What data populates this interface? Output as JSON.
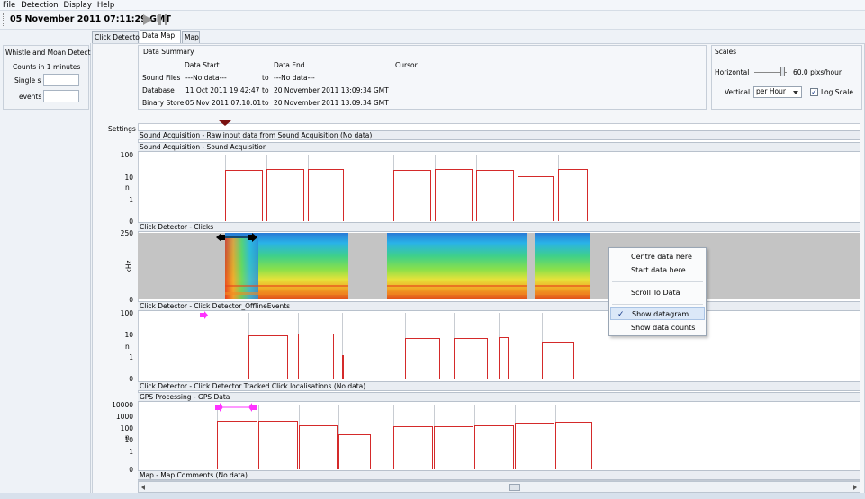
{
  "menu": [
    "File",
    "Detection",
    "Display",
    "Help"
  ],
  "toolbar": {
    "datetime": "05 November 2011 07:11:29 GMT"
  },
  "left_panel": {
    "title": "Whistle and Moan Detect",
    "counts_label": "Counts in 1 minutes",
    "single_label": "Single s",
    "events_label": "events"
  },
  "tabs": [
    "Click Detector",
    "Data Map",
    "Map"
  ],
  "data_summary": {
    "title": "Data Summary",
    "col_start": "Data Start",
    "col_end": "Data End",
    "col_cursor": "Cursor",
    "rows": [
      {
        "label": "Sound Files",
        "start": "---No data---",
        "to": "to",
        "end": "---No data---"
      },
      {
        "label": "Database",
        "start": "11 Oct 2011 19:42:47",
        "to": "to",
        "end": "20 November 2011 13:09:34 GMT"
      },
      {
        "label": "Binary Store",
        "start": "05 Nov 2011 07:10:01",
        "to": "to",
        "end": "20 November 2011 13:09:34 GMT"
      }
    ]
  },
  "scales": {
    "title": "Scales",
    "horizontal_label": "Horizontal",
    "horizontal_value": "60.0 pixs/hour",
    "vertical_label": "Vertical",
    "vertical_value": "per Hour",
    "log_scale_label": "Log Scale",
    "log_scale_checked": true
  },
  "settings_label": "Settings",
  "panels": [
    {
      "title": "Sound Acquisition - Raw input data from Sound Acquisition  (No data)"
    },
    {
      "title": "Sound Acquisition - Sound Acquisition",
      "yticks": [
        "100",
        "10",
        "1",
        "0"
      ],
      "ylabel": "n",
      "bars": [
        {
          "x0": 250,
          "x1": 292,
          "v": 20
        },
        {
          "x0": 296,
          "x1": 338,
          "v": 22
        },
        {
          "x0": 342,
          "x1": 382,
          "v": 22
        },
        {
          "x0": 437,
          "x1": 479,
          "v": 20
        },
        {
          "x0": 483,
          "x1": 525,
          "v": 22
        },
        {
          "x0": 529,
          "x1": 571,
          "v": 21
        },
        {
          "x0": 575,
          "x1": 615,
          "v": 11
        },
        {
          "x0": 620,
          "x1": 653,
          "v": 23
        }
      ]
    },
    {
      "title": "Click Detector - Clicks",
      "yticks": [
        "250",
        "0"
      ],
      "ylabel": "kHz"
    },
    {
      "title": "Click Detector - Click Detector_OfflineEvents",
      "yticks": [
        "100",
        "10",
        "1",
        "0"
      ],
      "ylabel": "n",
      "bars": [
        {
          "x0": 276,
          "x1": 320,
          "v": 9
        },
        {
          "x0": 331,
          "x1": 371,
          "v": 11
        },
        {
          "x0": 380,
          "x1": 382,
          "v": 1.2
        },
        {
          "x0": 450,
          "x1": 489,
          "v": 7
        },
        {
          "x0": 504,
          "x1": 542,
          "v": 7
        },
        {
          "x0": 554,
          "x1": 565,
          "v": 8
        },
        {
          "x0": 602,
          "x1": 638,
          "v": 5
        }
      ]
    },
    {
      "title": "Click Detector - Click Detector Tracked Click localisations  (No data)"
    },
    {
      "title": "GPS Processing - GPS Data",
      "yticks": [
        "10000",
        "1000",
        "100",
        "10",
        "1",
        "0"
      ],
      "ylabel": "n",
      "bars": [
        {
          "x0": 241,
          "x1": 286,
          "v": 600
        },
        {
          "x0": 287,
          "x1": 331,
          "v": 600
        },
        {
          "x0": 332,
          "x1": 375,
          "v": 250
        },
        {
          "x0": 376,
          "x1": 412,
          "v": 50
        },
        {
          "x0": 437,
          "x1": 481,
          "v": 220
        },
        {
          "x0": 482,
          "x1": 526,
          "v": 220
        },
        {
          "x0": 527,
          "x1": 571,
          "v": 260
        },
        {
          "x0": 572,
          "x1": 616,
          "v": 350
        },
        {
          "x0": 617,
          "x1": 658,
          "v": 500
        }
      ]
    },
    {
      "title": "Map - Map Comments  (No data)"
    }
  ],
  "context_menu": {
    "items": [
      {
        "label": "Centre data here",
        "checked": false
      },
      {
        "label": "Start data here",
        "checked": false
      },
      {
        "label": "Scroll To Data",
        "checked": false
      },
      {
        "label": "Show datagram",
        "checked": true
      },
      {
        "label": "Show data counts",
        "checked": false
      }
    ]
  },
  "colors": {
    "bar": "#d42a2a",
    "marker_magenta": "#ff33ff",
    "highlight": "#dbe8f8"
  }
}
